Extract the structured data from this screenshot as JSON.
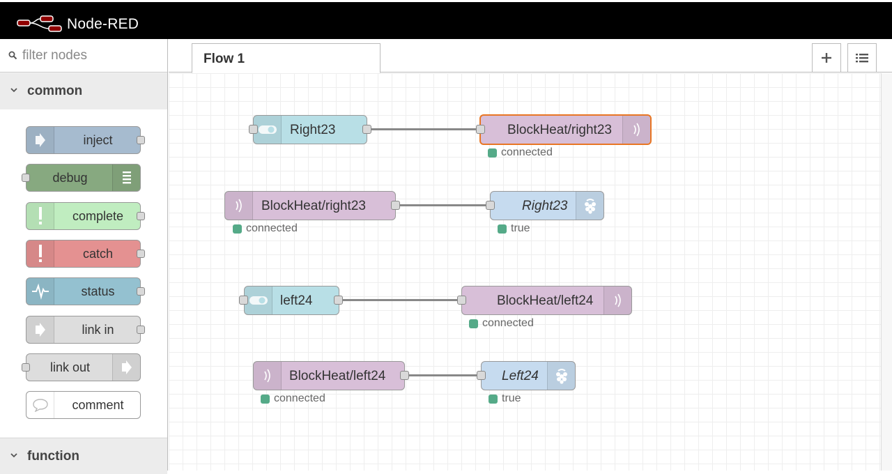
{
  "header": {
    "title": "Node-RED",
    "logo_icon": "node-red-logo"
  },
  "palette": {
    "filter_placeholder": "filter nodes",
    "categories": [
      {
        "label": "common",
        "expanded": true
      },
      {
        "label": "function",
        "expanded": true
      }
    ],
    "nodes": [
      {
        "label": "inject",
        "icon": "inject-arrow-icon",
        "color": "#a6bbcf"
      },
      {
        "label": "debug",
        "icon": "debug-list-icon",
        "color": "#87a980"
      },
      {
        "label": "complete",
        "icon": "exclamation-icon",
        "color": "#c0edc0"
      },
      {
        "label": "catch",
        "icon": "exclamation-icon",
        "color": "#e49191"
      },
      {
        "label": "status",
        "icon": "pulse-icon",
        "color": "#94c1d0"
      },
      {
        "label": "link in",
        "icon": "link-in-icon",
        "color": "#dddddd"
      },
      {
        "label": "link out",
        "icon": "link-out-icon",
        "color": "#dddddd"
      },
      {
        "label": "comment",
        "icon": "comment-bubble-icon",
        "color": "#ffffff"
      }
    ]
  },
  "workspace": {
    "tabs": [
      {
        "label": "Flow 1",
        "active": true
      }
    ],
    "add_button_icon": "plus-icon",
    "list_button_icon": "list-icon"
  },
  "flow": {
    "nodes": [
      {
        "id": "n1",
        "label": "Right23",
        "type": "dashboard-switch",
        "icon": "toggle-icon",
        "color": "#b8dfe6"
      },
      {
        "id": "n2",
        "label": "BlockHeat/right23",
        "type": "mqtt-out",
        "icon": "mqtt-wave-icon",
        "color": "#d8bfd8",
        "selected": true,
        "status": "connected"
      },
      {
        "id": "n3",
        "label": "BlockHeat/right23",
        "type": "mqtt-in",
        "icon": "mqtt-wave-icon",
        "color": "#d8bfd8",
        "status": "connected"
      },
      {
        "id": "n4",
        "label": "Right23",
        "type": "rpi-gpio-out",
        "icon": "raspberry-pi-icon",
        "color": "#c6dbef",
        "status": "true"
      },
      {
        "id": "n5",
        "label": "left24",
        "type": "dashboard-switch",
        "icon": "toggle-icon",
        "color": "#b8dfe6"
      },
      {
        "id": "n6",
        "label": "BlockHeat/left24",
        "type": "mqtt-out",
        "icon": "mqtt-wave-icon",
        "color": "#d8bfd8",
        "status": "connected"
      },
      {
        "id": "n7",
        "label": "BlockHeat/left24",
        "type": "mqtt-in",
        "icon": "mqtt-wave-icon",
        "color": "#d8bfd8",
        "status": "connected"
      },
      {
        "id": "n8",
        "label": "Left24",
        "type": "rpi-gpio-out",
        "icon": "raspberry-pi-icon",
        "color": "#c6dbef",
        "status": "true"
      }
    ],
    "wires": [
      {
        "from": "n1",
        "to": "n2"
      },
      {
        "from": "n3",
        "to": "n4"
      },
      {
        "from": "n5",
        "to": "n6"
      },
      {
        "from": "n7",
        "to": "n8"
      }
    ]
  }
}
